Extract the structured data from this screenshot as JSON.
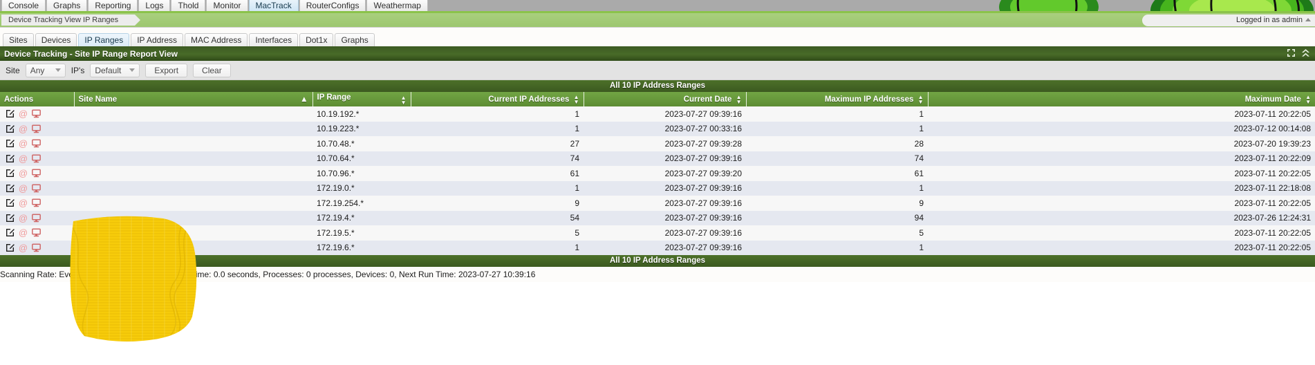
{
  "topnav": {
    "tabs": [
      {
        "label": "Console",
        "active": false
      },
      {
        "label": "Graphs",
        "active": false
      },
      {
        "label": "Reporting",
        "active": false
      },
      {
        "label": "Logs",
        "active": false
      },
      {
        "label": "Thold",
        "active": false
      },
      {
        "label": "Monitor",
        "active": false
      },
      {
        "label": "MacTrack",
        "active": true
      },
      {
        "label": "RouterConfigs",
        "active": false
      },
      {
        "label": "Weathermap",
        "active": false
      }
    ]
  },
  "breadcrumb": {
    "crumb": "Device Tracking View IP Ranges",
    "login_status": "Logged in as admin"
  },
  "subtabs": {
    "tabs": [
      {
        "label": "Sites",
        "active": false
      },
      {
        "label": "Devices",
        "active": false
      },
      {
        "label": "IP Ranges",
        "active": true
      },
      {
        "label": "IP Address",
        "active": false
      },
      {
        "label": "MAC Address",
        "active": false
      },
      {
        "label": "Interfaces",
        "active": false
      },
      {
        "label": "Dot1x",
        "active": false
      },
      {
        "label": "Graphs",
        "active": false
      }
    ]
  },
  "panel": {
    "title": "Device Tracking - Site IP Range Report View",
    "expand_icon": "expand-icon",
    "collapse_icon": "collapse-icon"
  },
  "filter": {
    "site_label": "Site",
    "site_value": "Any",
    "ips_label": "IP's",
    "ips_value": "Default",
    "export_label": "Export",
    "clear_label": "Clear"
  },
  "table": {
    "title": "All 10 IP Address Ranges",
    "footer_title": "All 10 IP Address Ranges",
    "columns": [
      {
        "label": "Actions",
        "align": "l",
        "sort": "none"
      },
      {
        "label": "Site Name",
        "align": "l",
        "sort": "asc"
      },
      {
        "label": "IP Range",
        "align": "l",
        "sort": "both"
      },
      {
        "label": "Current IP Addresses",
        "align": "r",
        "sort": "both"
      },
      {
        "label": "Current Date",
        "align": "r",
        "sort": "both"
      },
      {
        "label": "Maximum IP Addresses",
        "align": "r",
        "sort": "both"
      },
      {
        "label": "Maximum Date",
        "align": "r",
        "sort": "both"
      }
    ],
    "row_actions": [
      "edit-icon",
      "at-icon",
      "monitor-icon"
    ],
    "site_name_redacted": true,
    "rows": [
      {
        "site_name": "",
        "ip_range": "10.19.192.*",
        "current_ips": "1",
        "current_date": "2023-07-27 09:39:16",
        "max_ips": "1",
        "max_date": "2023-07-11 20:22:05"
      },
      {
        "site_name": "",
        "ip_range": "10.19.223.*",
        "current_ips": "1",
        "current_date": "2023-07-27 00:33:16",
        "max_ips": "1",
        "max_date": "2023-07-12 00:14:08"
      },
      {
        "site_name": "",
        "ip_range": "10.70.48.*",
        "current_ips": "27",
        "current_date": "2023-07-27 09:39:28",
        "max_ips": "28",
        "max_date": "2023-07-20 19:39:23"
      },
      {
        "site_name": "",
        "ip_range": "10.70.64.*",
        "current_ips": "74",
        "current_date": "2023-07-27 09:39:16",
        "max_ips": "74",
        "max_date": "2023-07-11 20:22:09"
      },
      {
        "site_name": "",
        "ip_range": "10.70.96.*",
        "current_ips": "61",
        "current_date": "2023-07-27 09:39:20",
        "max_ips": "61",
        "max_date": "2023-07-11 20:22:05"
      },
      {
        "site_name": "",
        "ip_range": "172.19.0.*",
        "current_ips": "1",
        "current_date": "2023-07-27 09:39:16",
        "max_ips": "1",
        "max_date": "2023-07-11 22:18:08"
      },
      {
        "site_name": "",
        "ip_range": "172.19.254.*",
        "current_ips": "9",
        "current_date": "2023-07-27 09:39:16",
        "max_ips": "9",
        "max_date": "2023-07-11 20:22:05"
      },
      {
        "site_name": "",
        "ip_range": "172.19.4.*",
        "current_ips": "54",
        "current_date": "2023-07-27 09:39:16",
        "max_ips": "94",
        "max_date": "2023-07-26 12:24:31"
      },
      {
        "site_name": "",
        "ip_range": "172.19.5.*",
        "current_ips": "5",
        "current_date": "2023-07-27 09:39:16",
        "max_ips": "5",
        "max_date": "2023-07-11 20:22:05"
      },
      {
        "site_name": "",
        "ip_range": "172.19.6.*",
        "current_ips": "1",
        "current_date": "2023-07-27 09:39:16",
        "max_ips": "1",
        "max_date": "2023-07-11 20:22:05"
      }
    ]
  },
  "status": {
    "text": "Scanning Rate: Every 1 Hours, Status: Idle, LastRuntime: 0.0 seconds, Processes: 0 processes, Devices: 0, Next Run Time: 2023-07-27 10:39:16"
  },
  "colors": {
    "accent_green": "#5d8c33",
    "dark_green": "#3c5a20",
    "crumb_green": "#a9cf7e",
    "row_odd": "#f7f7f7",
    "row_even": "#e5e8f0",
    "redaction_yellow": "#f5c711"
  }
}
